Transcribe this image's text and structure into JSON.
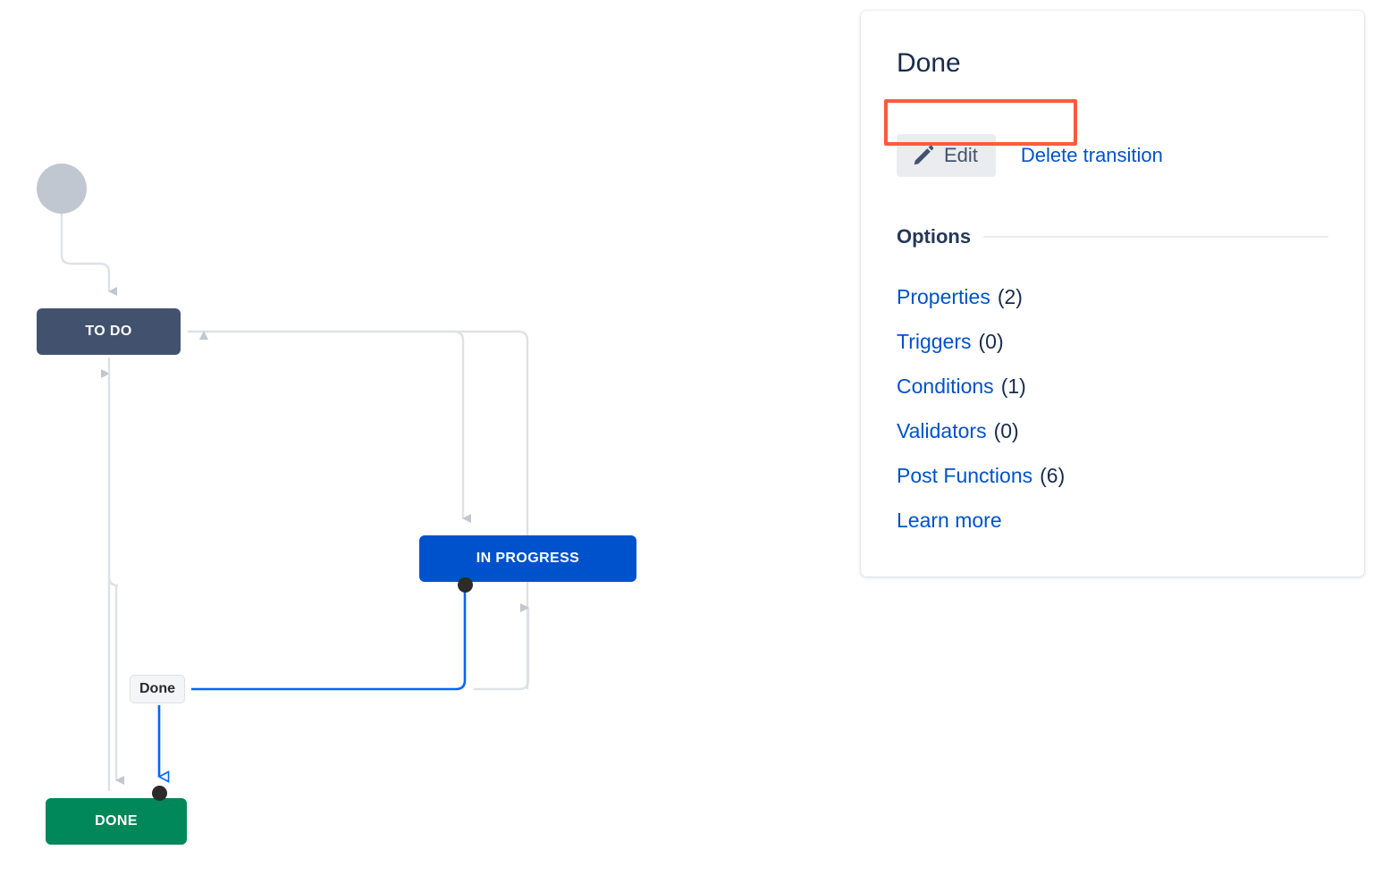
{
  "workflow": {
    "nodes": [
      {
        "id": "start",
        "label": "",
        "type": "start-circle"
      },
      {
        "id": "todo",
        "label": "TO DO",
        "color": "#42526E"
      },
      {
        "id": "inprogress",
        "label": "IN PROGRESS",
        "color": "#0052CC"
      },
      {
        "id": "done",
        "label": "DONE",
        "color": "#00875A"
      }
    ],
    "transition_label": "Done",
    "selected_transition_color": "#0065FF",
    "edge_color": "#DFE1E6"
  },
  "panel": {
    "title": "Done",
    "edit_label": "Edit",
    "edit_icon": "pencil-icon",
    "delete_label": "Delete transition",
    "options_heading": "Options",
    "options": [
      {
        "label": "Properties",
        "count": "(2)"
      },
      {
        "label": "Triggers",
        "count": "(0)"
      },
      {
        "label": "Conditions",
        "count": "(1)"
      },
      {
        "label": "Validators",
        "count": "(0)"
      },
      {
        "label": "Post Functions",
        "count": "(6)"
      },
      {
        "label": "Learn more",
        "count": ""
      }
    ],
    "highlight": {
      "target": "Conditions",
      "color": "#FA5B3D"
    }
  }
}
